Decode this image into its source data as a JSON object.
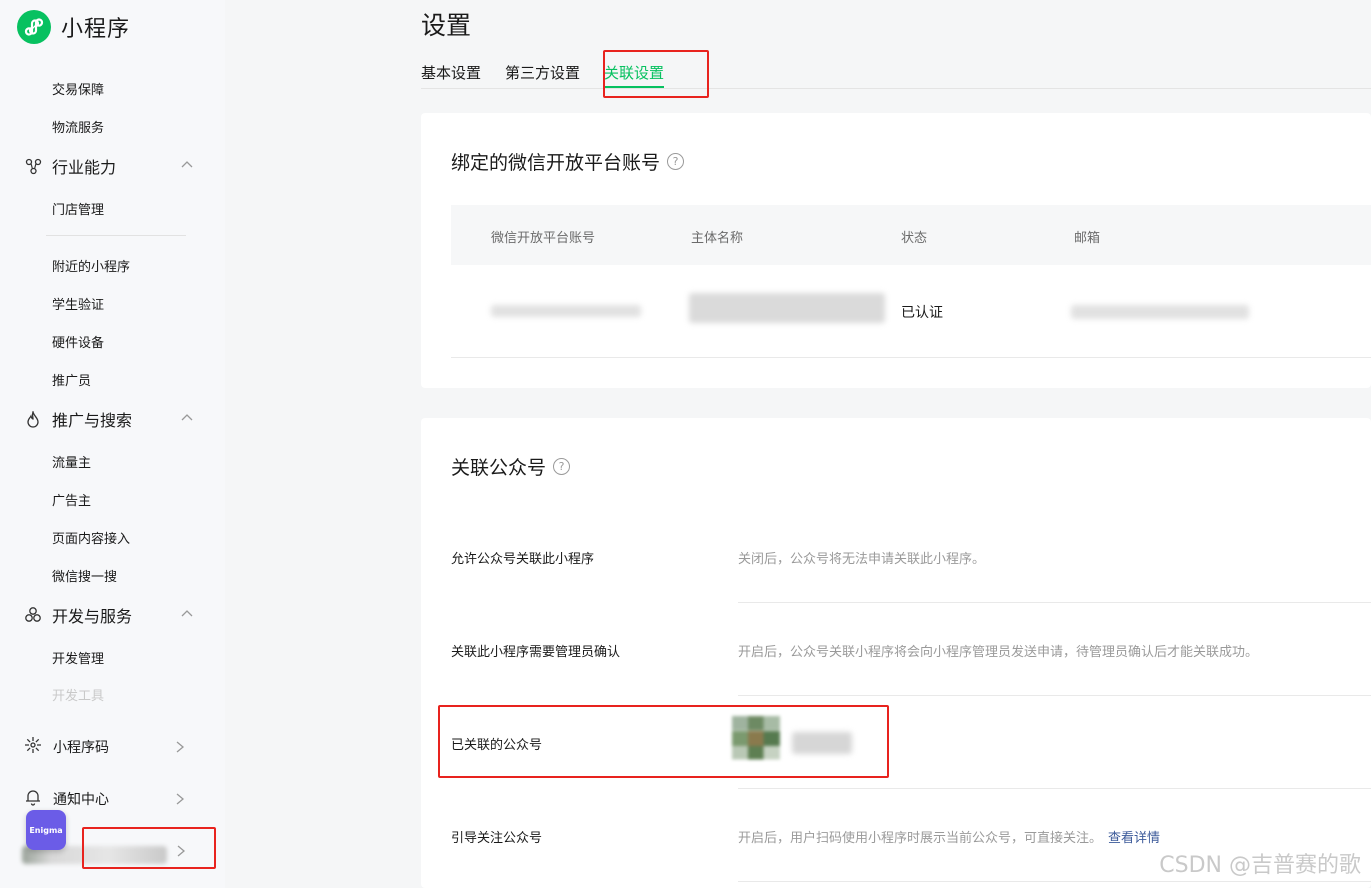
{
  "app": {
    "name": "小程序"
  },
  "sidebar": {
    "items_top": [
      {
        "label": "交易保障"
      },
      {
        "label": "物流服务"
      }
    ],
    "groups": [
      {
        "label": "行业能力",
        "icon": "nodes-icon",
        "children": [
          "门店管理"
        ]
      },
      {
        "label": "推广与搜索",
        "icon": "flame-icon",
        "children": [
          "流量主",
          "广告主",
          "页面内容接入",
          "微信搜一搜"
        ]
      },
      {
        "label": "开发与服务",
        "icon": "cluster-icon",
        "children": [
          "开发管理",
          "开发工具"
        ]
      }
    ],
    "after_divider": [
      "附近的小程序",
      "学生验证",
      "硬件设备",
      "推广员"
    ],
    "bottom": [
      {
        "label": "小程序码",
        "icon": "qrcode-icon"
      },
      {
        "label": "通知中心",
        "icon": "bell-icon"
      }
    ],
    "floating_badge": "Enigma"
  },
  "header": {
    "title": "设置",
    "tabs": [
      {
        "label": "基本设置",
        "active": false
      },
      {
        "label": "第三方设置",
        "active": false
      },
      {
        "label": "关联设置",
        "active": true
      }
    ]
  },
  "open_platform": {
    "title": "绑定的微信开放平台账号",
    "columns": [
      "微信开放平台账号",
      "主体名称",
      "状态",
      "邮箱"
    ],
    "row": {
      "status": "已认证"
    }
  },
  "official_account": {
    "title": "关联公众号",
    "settings": [
      {
        "label": "允许公众号关联此小程序",
        "desc": "关闭后，公众号将无法申请关联此小程序。"
      },
      {
        "label": "关联此小程序需要管理员确认",
        "desc": "开启后，公众号关联小程序将会向小程序管理员发送申请，待管理员确认后才能关联成功。"
      },
      {
        "label": "已关联的公众号",
        "desc": ""
      },
      {
        "label": "引导关注公众号",
        "desc": "开启后，用户扫码使用小程序时展示当前公众号，可直接关注。",
        "link": "查看详情"
      }
    ]
  },
  "watermark": "CSDN @吉普赛的歌",
  "colors": {
    "accent": "#07c160",
    "highlight": "#e8231e",
    "link": "#3c5a9a"
  }
}
